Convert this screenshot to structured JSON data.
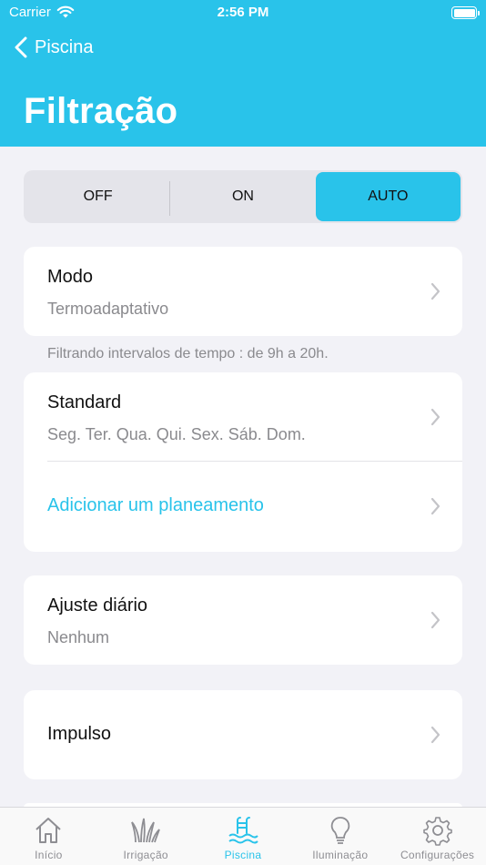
{
  "status_bar": {
    "carrier": "Carrier",
    "time": "2:56 PM"
  },
  "nav": {
    "back_label": "Piscina",
    "title": "Filtração"
  },
  "mode_selector": {
    "options": [
      "OFF",
      "ON",
      "AUTO"
    ],
    "selected": "AUTO"
  },
  "mode_card": {
    "title": "Modo",
    "value": "Termoadaptativo"
  },
  "footnote": "Filtrando intervalos de tempo : de 9h a 20h.",
  "schedule_card": {
    "title": "Standard",
    "days": "Seg. Ter. Qua. Qui. Sex. Sáb. Dom.",
    "add_label": "Adicionar um planeamento"
  },
  "daily_adjust_card": {
    "title": "Ajuste diário",
    "value": "Nenhum"
  },
  "impulse_card": {
    "title": "Impulso"
  },
  "tabbar": {
    "items": [
      {
        "label": "Início",
        "icon": "home-icon"
      },
      {
        "label": "Irrigação",
        "icon": "grass-icon"
      },
      {
        "label": "Piscina",
        "icon": "pool-icon"
      },
      {
        "label": "Iluminação",
        "icon": "bulb-icon"
      },
      {
        "label": "Configurações",
        "icon": "gear-icon"
      }
    ],
    "active": "Piscina"
  },
  "colors": {
    "accent": "#29c3ea",
    "background": "#f2f2f7",
    "secondary_text": "#8a8a8e"
  }
}
